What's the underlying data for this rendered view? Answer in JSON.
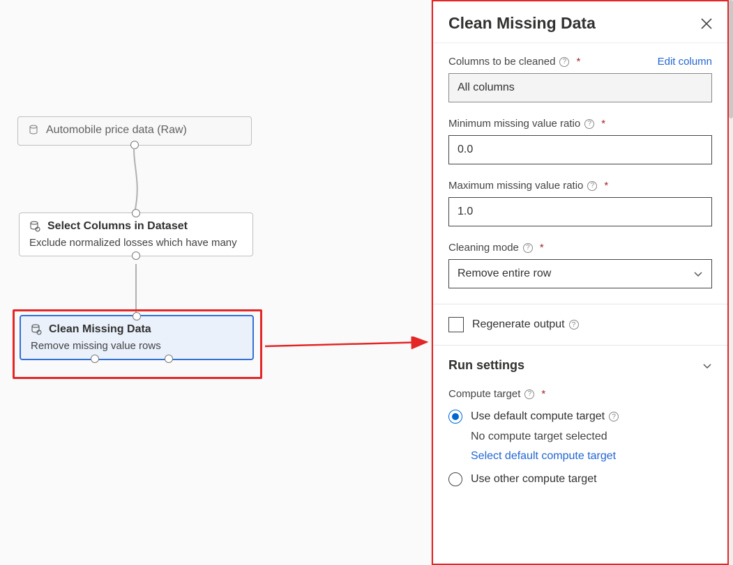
{
  "canvas": {
    "node1": {
      "title": "Automobile price data (Raw)"
    },
    "node2": {
      "title": "Select Columns in Dataset",
      "desc": "Exclude normalized losses which have many"
    },
    "node3": {
      "title": "Clean Missing Data",
      "desc": "Remove missing value rows"
    }
  },
  "panel": {
    "title": "Clean Missing Data",
    "columns_label": "Columns to be cleaned",
    "edit_column": "Edit column",
    "columns_value": "All columns",
    "min_label": "Minimum missing value ratio",
    "min_value": "0.0",
    "max_label": "Maximum missing value ratio",
    "max_value": "1.0",
    "mode_label": "Cleaning mode",
    "mode_value": "Remove entire row",
    "regen_label": "Regenerate output",
    "run_section": "Run settings",
    "compute_label": "Compute target",
    "radio_default": "Use default compute target",
    "radio_default_sub1": "No compute target selected",
    "radio_default_sub2": "Select default compute target",
    "radio_other": "Use other compute target"
  },
  "icons": {
    "help": "?",
    "asterisk": "*"
  }
}
